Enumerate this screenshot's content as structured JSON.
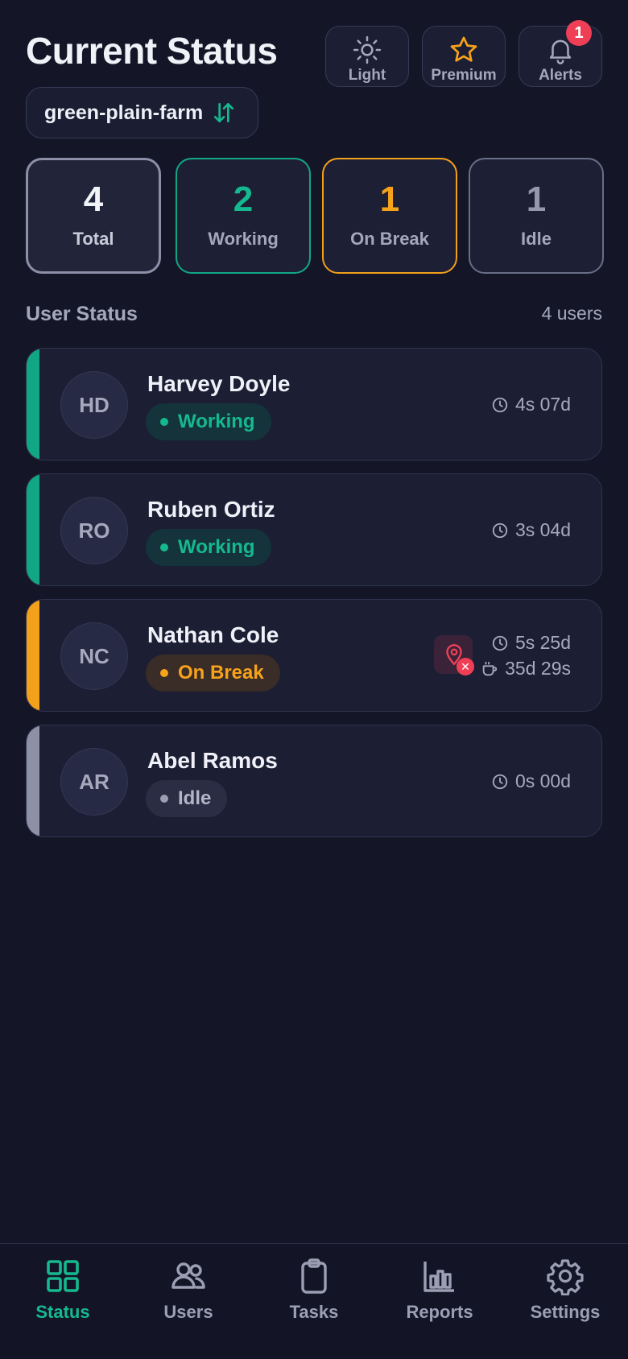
{
  "header": {
    "title": "Current Status",
    "buttons": [
      {
        "label": "Light",
        "icon": "sun-icon"
      },
      {
        "label": "Premium",
        "icon": "star-icon"
      },
      {
        "label": "Alerts",
        "icon": "bell-icon",
        "badge": "1"
      }
    ],
    "farm": {
      "name": "green-plain-farm",
      "icon": "swap-icon"
    }
  },
  "stats": [
    {
      "value": "4",
      "label": "Total"
    },
    {
      "value": "2",
      "label": "Working"
    },
    {
      "value": "1",
      "label": "On Break"
    },
    {
      "value": "1",
      "label": "Idle"
    }
  ],
  "section": {
    "title": "User Status",
    "count": "4 users"
  },
  "users": [
    {
      "initials": "HD",
      "name": "Harvey Doyle",
      "status": "Working",
      "time": "4s 07d"
    },
    {
      "initials": "RO",
      "name": "Ruben Ortiz",
      "status": "Working",
      "time": "3s 04d"
    },
    {
      "initials": "NC",
      "name": "Nathan Cole",
      "status": "On Break",
      "time": "5s 25d",
      "break_time": "35d 29s",
      "location_alert": "location-off-icon"
    },
    {
      "initials": "AR",
      "name": "Abel Ramos",
      "status": "Idle",
      "time": "0s 00d"
    }
  ],
  "nav": [
    {
      "label": "Status",
      "icon": "grid-icon",
      "active": true
    },
    {
      "label": "Users",
      "icon": "users-icon"
    },
    {
      "label": "Tasks",
      "icon": "clipboard-icon"
    },
    {
      "label": "Reports",
      "icon": "bar-chart-icon"
    },
    {
      "label": "Settings",
      "icon": "gear-icon"
    }
  ],
  "colors": {
    "background": "#141628",
    "working": "#16b98f",
    "on_break": "#f7a21b",
    "idle": "#9597ae",
    "alert": "#ef3f57"
  }
}
